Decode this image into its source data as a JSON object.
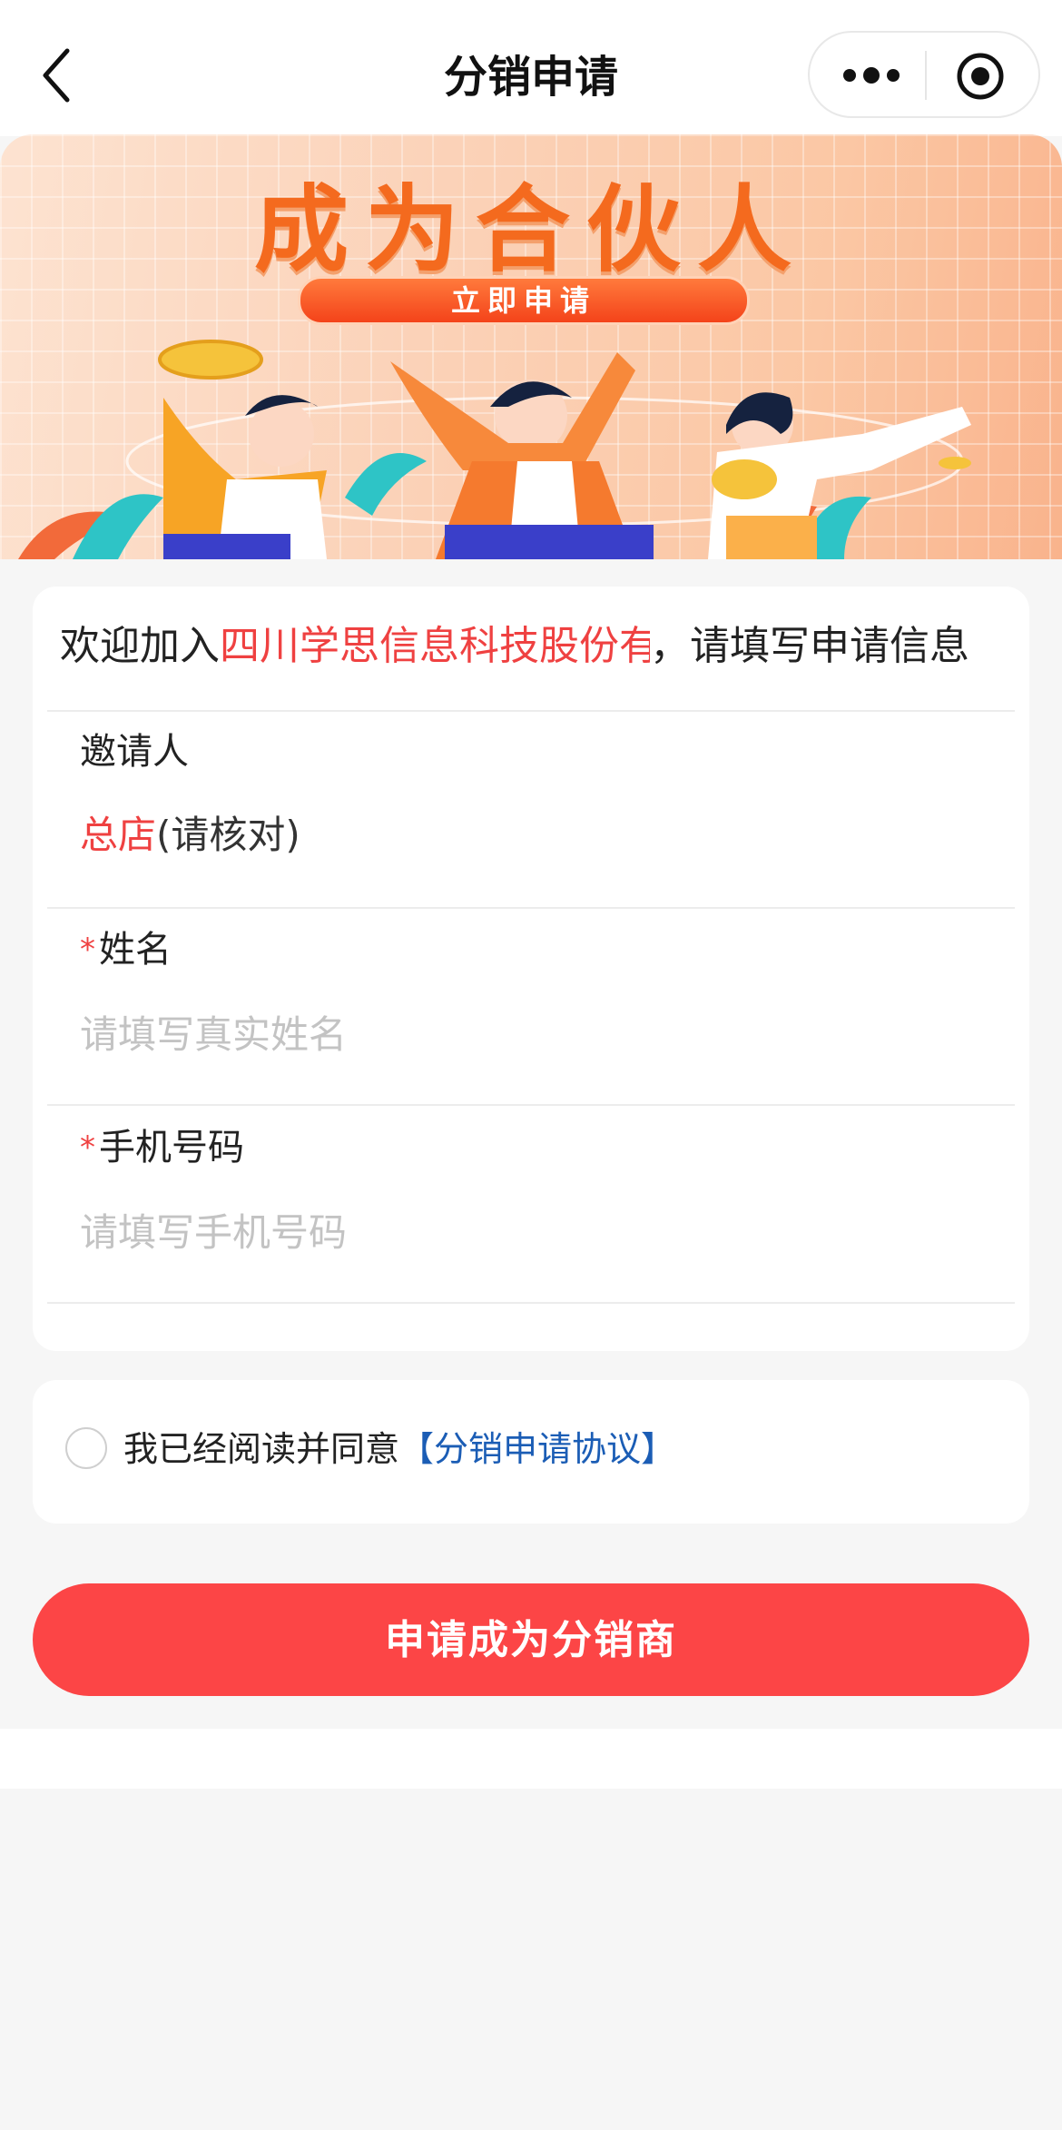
{
  "navbar": {
    "title": "分销申请"
  },
  "banner": {
    "headline": "成为合伙人",
    "cta_label": "立即申请"
  },
  "form": {
    "welcome_prefix": "欢迎加入",
    "company_name": "四川学思信息科技股份有限公司",
    "welcome_suffix": "，请填写申请信息",
    "inviter": {
      "label": "邀请人",
      "value": "总店",
      "hint": "(请核对)"
    },
    "name": {
      "required_mark": "*",
      "label": "姓名",
      "placeholder": "请填写真实姓名"
    },
    "phone": {
      "required_mark": "*",
      "label": "手机号码",
      "placeholder": "请填写手机号码"
    }
  },
  "agreement": {
    "text": "我已经阅读并同意",
    "link_label": "【分销申请协议】"
  },
  "submit": {
    "label": "申请成为分销商"
  },
  "colors": {
    "accent_red": "#fc4546",
    "link_blue": "#1b5db5",
    "banner_orange": "#f46a1e"
  }
}
